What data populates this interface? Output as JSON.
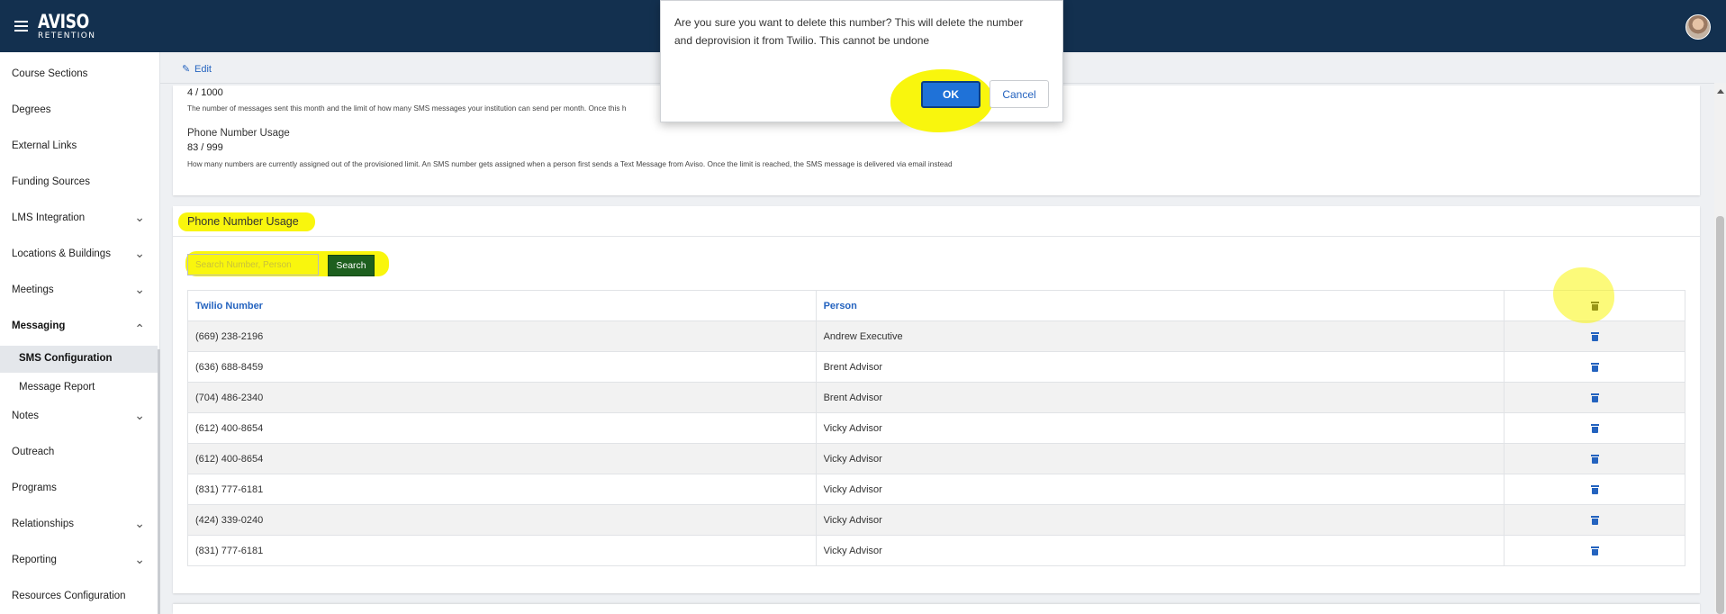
{
  "header": {
    "logo_line1": "AVISO",
    "logo_line2": "RETENTION"
  },
  "sidebar": {
    "items": [
      {
        "label": "Course Sections"
      },
      {
        "label": "Degrees"
      },
      {
        "label": "External Links"
      },
      {
        "label": "Funding Sources"
      },
      {
        "label": "LMS Integration"
      },
      {
        "label": "Locations & Buildings"
      },
      {
        "label": "Meetings"
      },
      {
        "label": "Messaging"
      },
      {
        "label": "SMS Configuration"
      },
      {
        "label": "Message Report"
      },
      {
        "label": "Notes"
      },
      {
        "label": "Outreach"
      },
      {
        "label": "Programs"
      },
      {
        "label": "Relationships"
      },
      {
        "label": "Reporting"
      },
      {
        "label": "Resources Configuration"
      }
    ]
  },
  "edit": {
    "label": "Edit"
  },
  "usage": {
    "messages_value": "4 / 1000",
    "messages_desc": "The number of messages sent this month and the limit of how many SMS messages your institution can send per month. Once this h",
    "phone_heading": "Phone Number Usage",
    "phone_value": "83 / 999",
    "phone_desc": "How many numbers are currently assigned out of the provisioned limit. An SMS number gets assigned when a person first sends a Text Message from Aviso. Once the limit is reached, the SMS message is delivered via email instead"
  },
  "phone_usage": {
    "title": "Phone Number Usage",
    "search_placeholder": "Search Number, Person",
    "search_button": "Search",
    "columns": [
      "Twilio Number",
      "Person"
    ],
    "rows": [
      {
        "number": "(669) 238-2196",
        "person": "Andrew Executive"
      },
      {
        "number": "(636) 688-8459",
        "person": "Brent Advisor"
      },
      {
        "number": "(704) 486-2340",
        "person": "Brent Advisor"
      },
      {
        "number": "(612) 400-8654",
        "person": "Vicky Advisor"
      },
      {
        "number": "(612) 400-8654",
        "person": "Vicky Advisor"
      },
      {
        "number": "(831) 777-6181",
        "person": "Vicky Advisor"
      },
      {
        "number": "(424) 339-0240",
        "person": "Vicky Advisor"
      },
      {
        "number": "(831) 777-6181",
        "person": "Vicky Advisor"
      }
    ]
  },
  "modal": {
    "message": "Are you sure you want to delete this number? This will delete the number and deprovision it from Twilio. This cannot be undone",
    "ok": "OK",
    "cancel": "Cancel"
  },
  "colors": {
    "header_bg": "#13304f",
    "link_blue": "#2463bf",
    "highlight": "#f9f60d",
    "search_green": "#1d5f1e",
    "ok_blue": "#1f72d8"
  },
  "icons": [
    "hamburger-icon",
    "avatar",
    "pencil-icon",
    "chevron-down-icon",
    "chevron-up-icon",
    "trash-icon"
  ]
}
